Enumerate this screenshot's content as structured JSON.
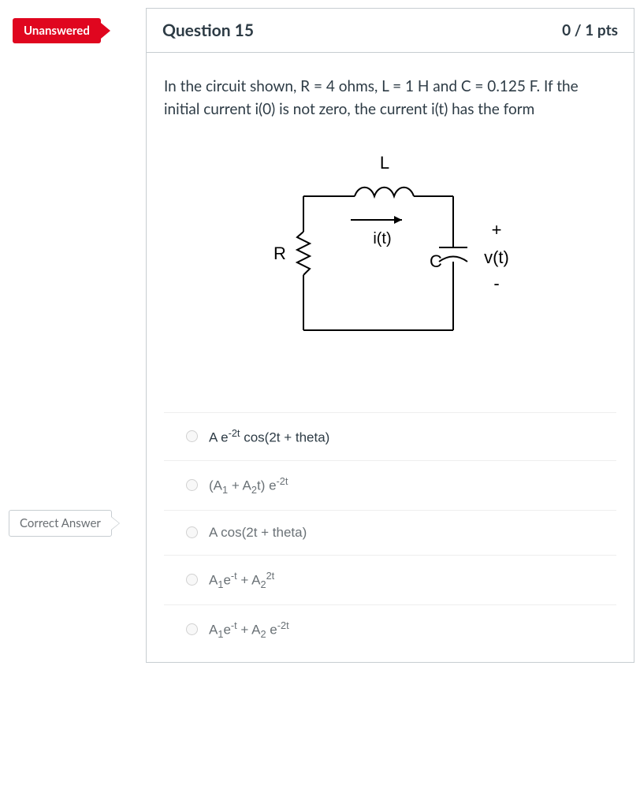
{
  "tags": {
    "unanswered": "Unanswered",
    "correct": "Correct Answer"
  },
  "header": {
    "title": "Question 15",
    "points": "0 / 1 pts"
  },
  "question_text": "In the circuit shown, R = 4 ohms, L = 1 H and C = 0.125 F. If the initial current i(0) is not zero, the current i(t) has the form",
  "diagram": {
    "labels": {
      "L": "L",
      "R": "R",
      "C": "C",
      "i": "i(t)",
      "plus": "+",
      "v": "v(t)",
      "minus": "-"
    }
  },
  "answers": [
    {
      "html": "A e<sup>-2t</sup> cos(2t + theta)",
      "correct": true
    },
    {
      "html": "(A<sub>1</sub> + A<sub>2</sub>t) e<sup>-2t</sup>",
      "correct": false
    },
    {
      "html": "A cos(2t + theta)",
      "correct": false
    },
    {
      "html": "A<sub>1</sub>e<sup>-t</sup> + A<sub>2</sub><sup>2t</sup>",
      "correct": false
    },
    {
      "html": "A<sub>1</sub>e<sup>-t</sup> + A<sub>2</sub> e<sup>-2t</sup>",
      "correct": false
    }
  ]
}
